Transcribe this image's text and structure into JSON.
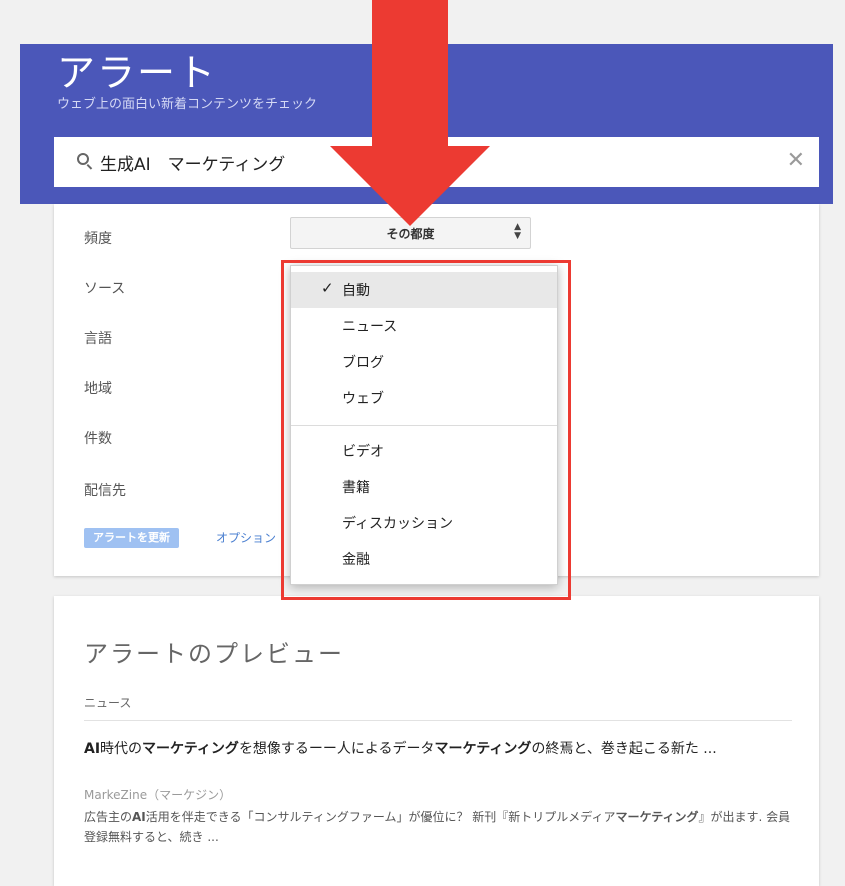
{
  "app": {
    "title": "アラート",
    "subtitle": "ウェブ上の面白い新着コンテンツをチェック"
  },
  "search": {
    "value": "生成AI　マーケティング",
    "clear_glyph": "✕"
  },
  "options": {
    "labels": [
      "頻度",
      "ソース",
      "言語",
      "地域",
      "件数",
      "配信先"
    ],
    "frequency_value": "その都度",
    "update_button": "アラートを更新",
    "options_link": "オプション"
  },
  "source_dropdown": {
    "check_glyph": "✓",
    "selected": "自動",
    "group1": [
      "自動",
      "ニュース",
      "ブログ",
      "ウェブ"
    ],
    "group2": [
      "ビデオ",
      "書籍",
      "ディスカッション",
      "金融"
    ]
  },
  "preview": {
    "title": "アラートのプレビュー",
    "section": "ニュース",
    "article": {
      "title_parts": [
        {
          "text": "AI",
          "bold": true
        },
        {
          "text": "時代の",
          "bold": false
        },
        {
          "text": "マーケティング",
          "bold": true
        },
        {
          "text": "を想像するーー人によるデータ",
          "bold": false
        },
        {
          "text": "マーケティング",
          "bold": true
        },
        {
          "text": "の終焉と、巻き起こる新た ...",
          "bold": false
        }
      ],
      "source": "MarkeZine（マーケジン）",
      "snippet_parts": [
        {
          "text": "広告主の",
          "bold": false
        },
        {
          "text": "AI",
          "bold": true
        },
        {
          "text": "活用を伴走できる「コンサルティングファーム」が優位に？ 新刊『新トリプルメディア",
          "bold": false
        },
        {
          "text": "マーケティング",
          "bold": true
        },
        {
          "text": "』が出ます. 会員登録無料すると、続き ...",
          "bold": false
        }
      ]
    }
  },
  "colors": {
    "header_bg": "#4b57b9",
    "annotation_red": "#ec3a32",
    "update_button": "#9fc1f2",
    "link": "#4a7fd0"
  }
}
